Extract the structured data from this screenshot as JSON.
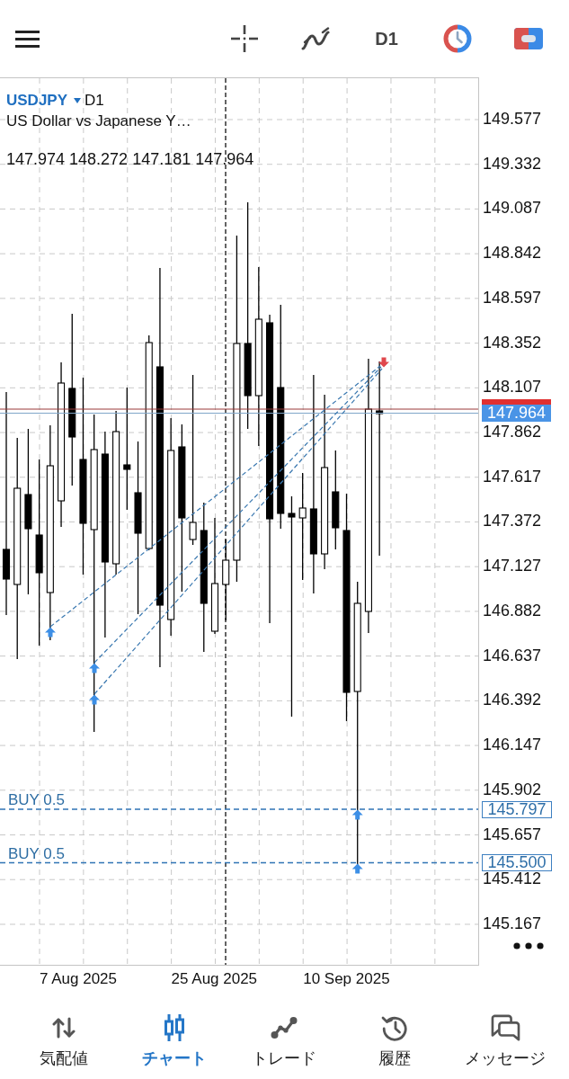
{
  "toolbar": {
    "timeframe": "D1"
  },
  "chart": {
    "symbol": "USDJPY",
    "timeframe": "D1",
    "description": "US Dollar vs Japanese Y…",
    "ohlc": "147.974 148.272 147.181 147.964",
    "price_ticks": [
      "149.577",
      "149.332",
      "149.087",
      "148.842",
      "148.597",
      "148.352",
      "148.107",
      "147.862",
      "147.617",
      "147.372",
      "147.127",
      "146.882",
      "146.637",
      "146.392",
      "146.147",
      "145.902",
      "145.657",
      "145.412",
      "145.167"
    ],
    "bid_price": "147.964",
    "orders": [
      {
        "label": "BUY 0.5",
        "price": "145.797"
      },
      {
        "label": "BUY 0.5",
        "price": "145.500"
      }
    ],
    "dates": [
      "7 Aug 2025",
      "25 Aug 2025",
      "10 Sep 2025"
    ]
  },
  "bottom_nav": [
    {
      "label": "気配値",
      "selected": false
    },
    {
      "label": "チャート",
      "selected": true
    },
    {
      "label": "トレード",
      "selected": false
    },
    {
      "label": "履歴",
      "selected": false
    },
    {
      "label": "メッセージ",
      "selected": false
    }
  ]
}
